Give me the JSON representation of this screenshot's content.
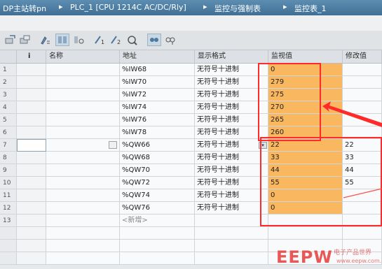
{
  "breadcrumb": {
    "items": [
      "DP主站转pn",
      "PLC_1 [CPU 1214C AC/DC/Rly]",
      "监控与强制表",
      "监控表_1"
    ],
    "separator": "▸"
  },
  "toolbar": {
    "icons": [
      "write-icon",
      "copy-icon",
      "rename-icon",
      "monitor-all-icon",
      "monitor-once-icon",
      "modify-icon",
      "modify-now-icon",
      "force-icon",
      "show-hide-icon",
      "show-options-icon"
    ]
  },
  "table": {
    "headers": {
      "num": "",
      "info": "i",
      "name": "名称",
      "address": "地址",
      "format": "显示格式",
      "monitor": "监视值",
      "modify": "修改值"
    },
    "rows": [
      {
        "num": "1",
        "address": "%IW68",
        "format": "无符号十进制",
        "monitor": "0",
        "modify": ""
      },
      {
        "num": "2",
        "address": "%IW70",
        "format": "无符号十进制",
        "monitor": "279",
        "modify": ""
      },
      {
        "num": "3",
        "address": "%IW72",
        "format": "无符号十进制",
        "monitor": "275",
        "modify": ""
      },
      {
        "num": "4",
        "address": "%IW74",
        "format": "无符号十进制",
        "monitor": "270",
        "modify": ""
      },
      {
        "num": "5",
        "address": "%IW76",
        "format": "无符号十进制",
        "monitor": "265",
        "modify": ""
      },
      {
        "num": "6",
        "address": "%IW78",
        "format": "无符号十进制",
        "monitor": "260",
        "modify": ""
      },
      {
        "num": "7",
        "address": "%QW66",
        "format": "无符号十进制",
        "monitor": "22",
        "modify": "22"
      },
      {
        "num": "8",
        "address": "%QW68",
        "format": "无符号十进制",
        "monitor": "33",
        "modify": "33"
      },
      {
        "num": "9",
        "address": "%QW70",
        "format": "无符号十进制",
        "monitor": "44",
        "modify": "44"
      },
      {
        "num": "10",
        "address": "%QW72",
        "format": "无符号十进制",
        "monitor": "55",
        "modify": "55"
      },
      {
        "num": "11",
        "address": "%QW74",
        "format": "无符号十进制",
        "monitor": "0",
        "modify": ""
      },
      {
        "num": "12",
        "address": "%QW76",
        "format": "无符号十进制",
        "monitor": "0",
        "modify": ""
      },
      {
        "num": "13",
        "address": "<新增>",
        "format": "",
        "monitor": "",
        "modify": ""
      }
    ]
  },
  "colors": {
    "monitor_fill": "#f9b85f",
    "annotation_red": "#ff2a2a",
    "title_blue": "#4a7ca3"
  },
  "watermark": {
    "logo": "EEPW",
    "subtitle": "电子产品世界",
    "url": "www.eepw.com.cn"
  }
}
